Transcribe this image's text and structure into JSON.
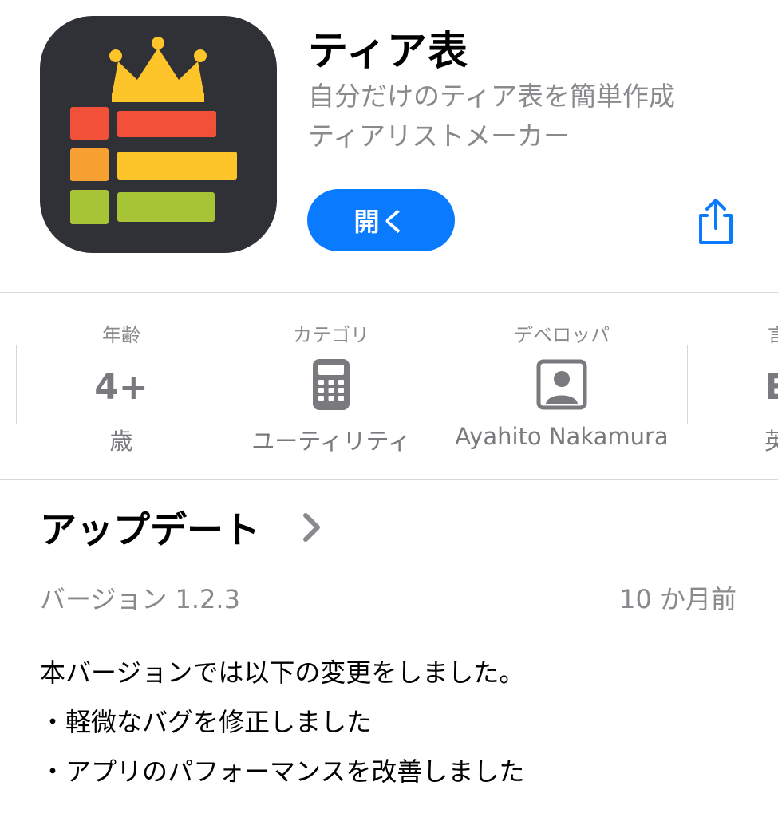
{
  "app": {
    "title": "ティア表",
    "subtitle_line1": "自分だけのティア表を簡単作成",
    "subtitle_line2": "ティアリストメーカー",
    "open_label": "開く"
  },
  "info": {
    "age": {
      "label": "年齢",
      "value": "4+",
      "sub": "歳"
    },
    "category": {
      "label": "カテゴリ",
      "icon": "calculator-icon",
      "sub": "ユーティリティ"
    },
    "developer": {
      "label": "デベロッパ",
      "icon": "person-icon",
      "sub": "Ayahito Nakamura"
    },
    "language": {
      "label": "言",
      "value": "E",
      "sub": "英"
    }
  },
  "updates": {
    "title": "アップデート",
    "version": "バージョン 1.2.3",
    "ago": "10 か月前",
    "notes": [
      "本バージョンでは以下の変更をしました。",
      "・軽微なバグを修正しました",
      "・アプリのパフォーマンスを改善しました"
    ]
  },
  "colors": {
    "accent": "#0a7aff",
    "icon_bg": "#2f3136",
    "crown": "#fdc52a",
    "tier_red": "#f3503a",
    "tier_orange": "#f6a132",
    "tier_yellow": "#fdc52a",
    "tier_green": "#a6c436"
  }
}
